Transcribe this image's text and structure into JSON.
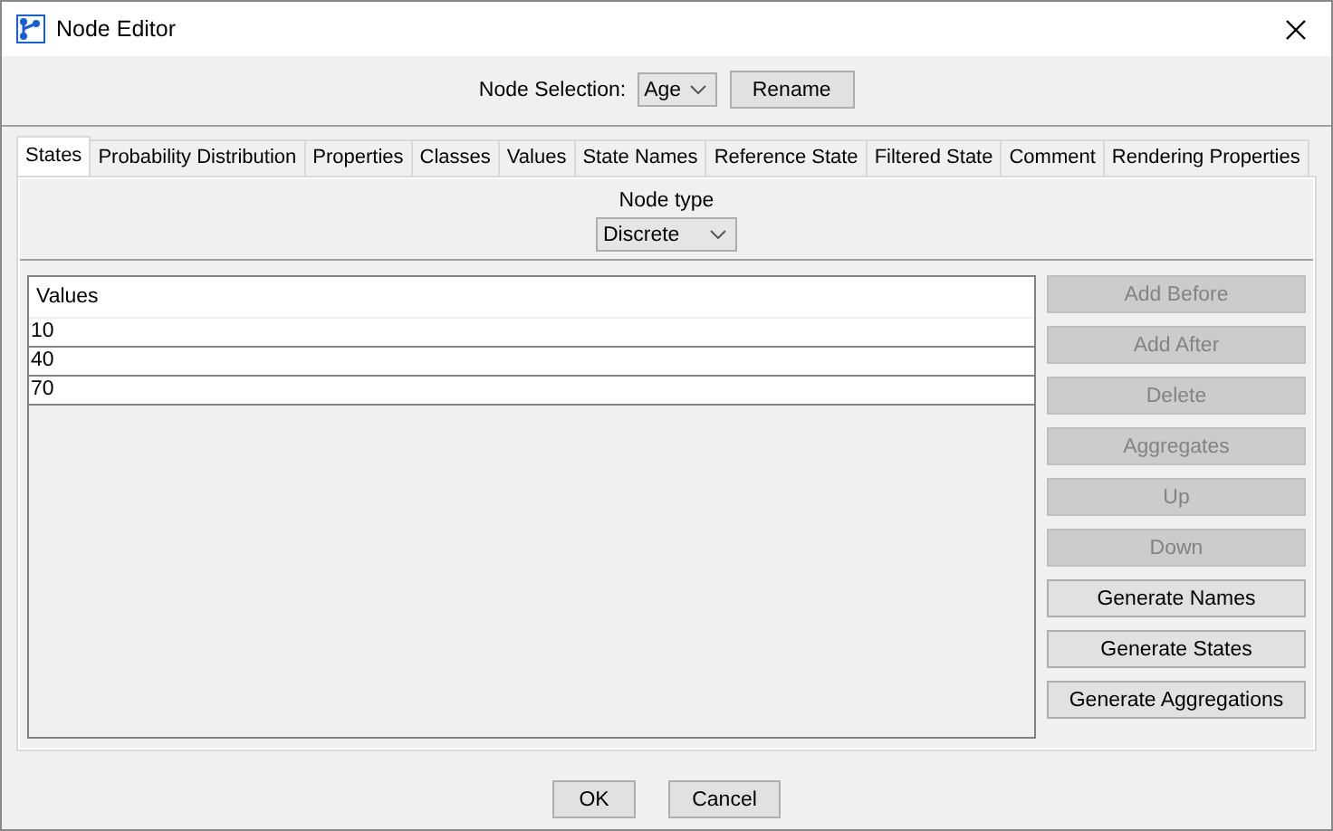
{
  "window": {
    "title": "Node Editor"
  },
  "node_selection": {
    "label": "Node Selection:",
    "value": "Age",
    "rename_button": "Rename"
  },
  "tabs": [
    {
      "label": "States",
      "selected": true
    },
    {
      "label": "Probability Distribution",
      "selected": false
    },
    {
      "label": "Properties",
      "selected": false
    },
    {
      "label": "Classes",
      "selected": false
    },
    {
      "label": "Values",
      "selected": false
    },
    {
      "label": "State Names",
      "selected": false
    },
    {
      "label": "Reference State",
      "selected": false
    },
    {
      "label": "Filtered State",
      "selected": false
    },
    {
      "label": "Comment",
      "selected": false
    },
    {
      "label": "Rendering Properties",
      "selected": false
    }
  ],
  "node_type": {
    "label": "Node type",
    "value": "Discrete"
  },
  "table": {
    "columns": [
      "Values"
    ],
    "rows": [
      "10",
      "40",
      "70"
    ]
  },
  "side_buttons": [
    {
      "label": "Add Before",
      "disabled": true
    },
    {
      "label": "Add After",
      "disabled": true
    },
    {
      "label": "Delete",
      "disabled": true
    },
    {
      "label": "Aggregates",
      "disabled": true
    },
    {
      "label": "Up",
      "disabled": true
    },
    {
      "label": "Down",
      "disabled": true
    },
    {
      "label": "Generate Names",
      "disabled": false
    },
    {
      "label": "Generate States",
      "disabled": false
    },
    {
      "label": "Generate Aggregations",
      "disabled": false
    }
  ],
  "footer_buttons": [
    "OK",
    "Cancel"
  ]
}
